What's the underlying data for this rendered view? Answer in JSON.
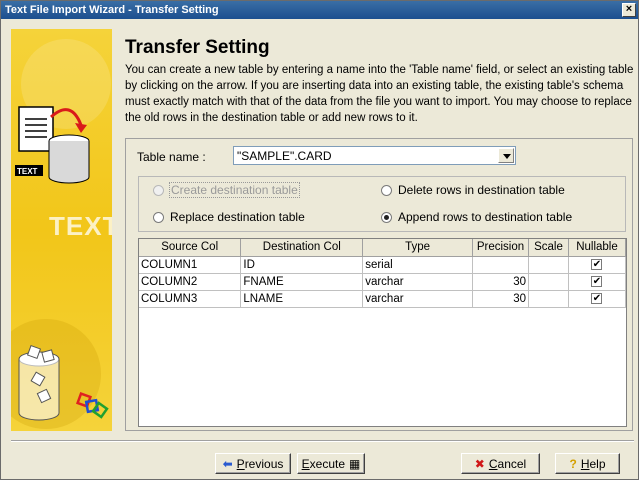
{
  "window": {
    "title": "Text File Import Wizard - Transfer Setting"
  },
  "sidebar": {
    "caption": "TEXT",
    "doc_label": "TEXT"
  },
  "page": {
    "heading": "Transfer Setting",
    "description": "You can create a new table by entering a name into the 'Table name' field, or select an existing table by clicking on the arrow. If you are inserting data into an existing table, the existing table's schema must exactly match with that of the data from the file you want to import. You may choose to replace the old rows in the destination table or add new rows to it."
  },
  "table_name": {
    "label": "Table name :",
    "value": "\"SAMPLE\".CARD"
  },
  "options": {
    "create": "Create destination table",
    "replace": "Replace destination table",
    "delete": "Delete rows in destination table",
    "append": "Append rows to destination table",
    "selected": "append"
  },
  "mapping": {
    "headers": [
      "Source Col",
      "Destination Col",
      "Type",
      "Precision",
      "Scale",
      "Nullable"
    ],
    "rows": [
      {
        "source": "COLUMN1",
        "dest": "ID",
        "type": "serial",
        "precision": "",
        "scale": "",
        "nullable": "✔"
      },
      {
        "source": "COLUMN2",
        "dest": "FNAME",
        "type": "varchar",
        "precision": "30",
        "scale": "",
        "nullable": "✔"
      },
      {
        "source": "COLUMN3",
        "dest": "LNAME",
        "type": "varchar",
        "precision": "30",
        "scale": "",
        "nullable": "✔"
      }
    ]
  },
  "buttons": {
    "previous": "Previous",
    "execute": "Execute",
    "cancel": "Cancel",
    "help": "Help"
  }
}
